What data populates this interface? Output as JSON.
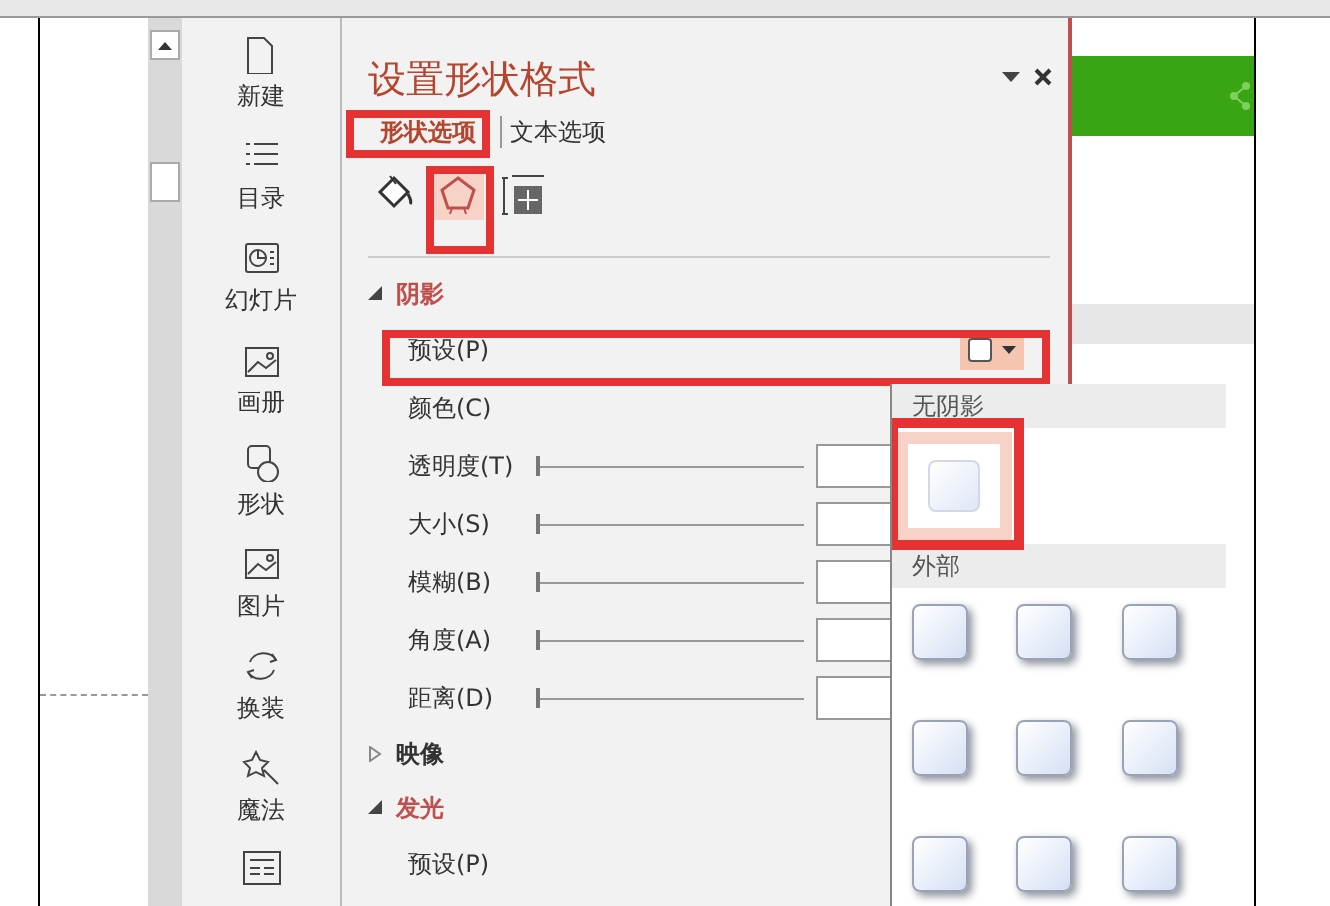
{
  "sidebar": {
    "items": [
      {
        "label": "新建"
      },
      {
        "label": "目录"
      },
      {
        "label": "幻灯片"
      },
      {
        "label": "画册"
      },
      {
        "label": "形状"
      },
      {
        "label": "图片"
      },
      {
        "label": "换装"
      },
      {
        "label": "魔法"
      }
    ]
  },
  "panel": {
    "title": "设置形状格式",
    "tabs": [
      {
        "label": "形状选项",
        "selected": true
      },
      {
        "label": "文本选项",
        "selected": false
      }
    ],
    "icon_tabs": [
      {
        "selected": false
      },
      {
        "selected": true
      },
      {
        "selected": false
      }
    ],
    "sections": [
      {
        "title": "阴影",
        "expanded": true,
        "rows": [
          {
            "kind": "dropdown",
            "label": "预设(P)"
          },
          {
            "kind": "color",
            "label": "颜色(C)"
          },
          {
            "kind": "slider",
            "label": "透明度(T)",
            "level": 0
          },
          {
            "kind": "slider",
            "label": "大小(S)",
            "level": 0
          },
          {
            "kind": "slider",
            "label": "模糊(B)",
            "level": 0
          },
          {
            "kind": "slider",
            "label": "角度(A)",
            "level": 0
          },
          {
            "kind": "slider",
            "label": "距离(D)",
            "level": 0
          }
        ]
      },
      {
        "title": "映像",
        "expanded": false
      },
      {
        "title": "发光",
        "expanded": true,
        "rows": [
          {
            "kind": "label",
            "label": "预设(P)"
          }
        ]
      }
    ]
  },
  "preset_popup": {
    "groups": [
      {
        "title": "无阴影",
        "items": [
          {
            "selected": true
          }
        ]
      },
      {
        "title": "外部",
        "items": [
          {
            "selected": false
          },
          {
            "selected": false
          },
          {
            "selected": false
          },
          {
            "selected": false
          },
          {
            "selected": false
          },
          {
            "selected": false
          },
          {
            "selected": false
          },
          {
            "selected": false
          },
          {
            "selected": false
          }
        ]
      }
    ]
  }
}
